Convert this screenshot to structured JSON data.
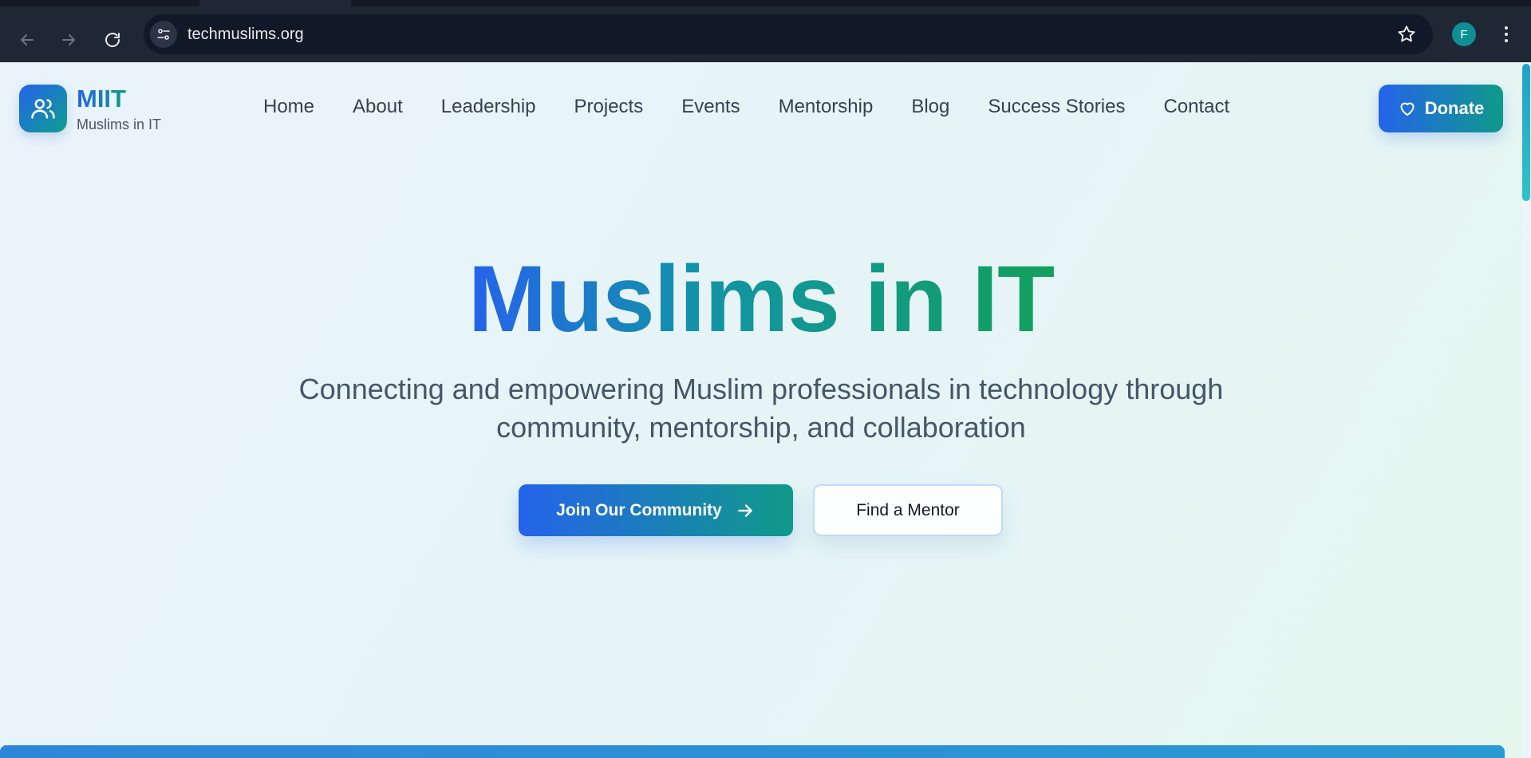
{
  "browser": {
    "url": "techmuslims.org",
    "profile_initial": "F",
    "icons": {
      "back": "arrow-left-icon",
      "forward": "arrow-right-icon",
      "reload": "reload-icon",
      "site_info": "tune-icon",
      "bookmark": "star-icon",
      "menu": "kebab-menu-icon"
    }
  },
  "site": {
    "brand_name": "MIIT",
    "brand_tagline": "Muslims in IT",
    "nav": [
      "Home",
      "About",
      "Leadership",
      "Projects",
      "Events",
      "Mentorship",
      "Blog",
      "Success Stories",
      "Contact"
    ],
    "donate_label": "Donate"
  },
  "hero": {
    "title": "Muslims in IT",
    "subtitle_line1": "Connecting and empowering Muslim professionals in technology through",
    "subtitle_line2": "community, mentorship, and collaboration",
    "primary_cta": "Join Our Community",
    "secondary_cta": "Find a Mentor"
  },
  "colors": {
    "brand_blue": "#2563eb",
    "brand_teal": "#0f9a88",
    "brand_green": "#12a05c",
    "chrome_bg": "#1f2735"
  }
}
